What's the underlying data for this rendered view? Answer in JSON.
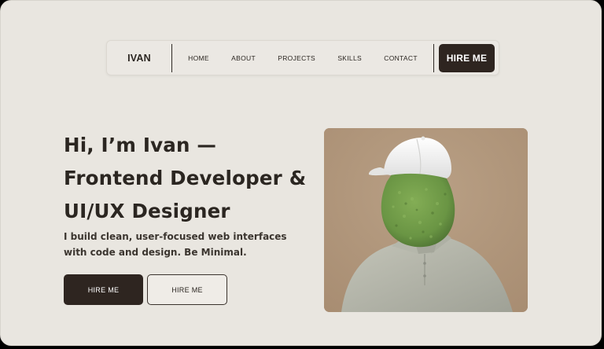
{
  "nav": {
    "brand": "IVAN",
    "links": [
      "HOME",
      "ABOUT",
      "PROJECTS",
      "SKILLS",
      "CONTACT"
    ],
    "cta": "HIRE ME"
  },
  "hero": {
    "headline": [
      "Hi, I’m Ivan —",
      "Frontend Developer &",
      "UI/UX Designer"
    ],
    "subtext": [
      "I build clean, user-focused web interfaces",
      "with code and design. Be Minimal."
    ],
    "primary_button": "HIRE ME",
    "secondary_button": "HIRE ME"
  },
  "colors": {
    "background": "#e9e6e0",
    "dark": "#2e2520",
    "image_background": "#b09579",
    "cap": "#f3f3f1",
    "moss": "#6f9a4a",
    "shirt": "#b7b8ab"
  }
}
